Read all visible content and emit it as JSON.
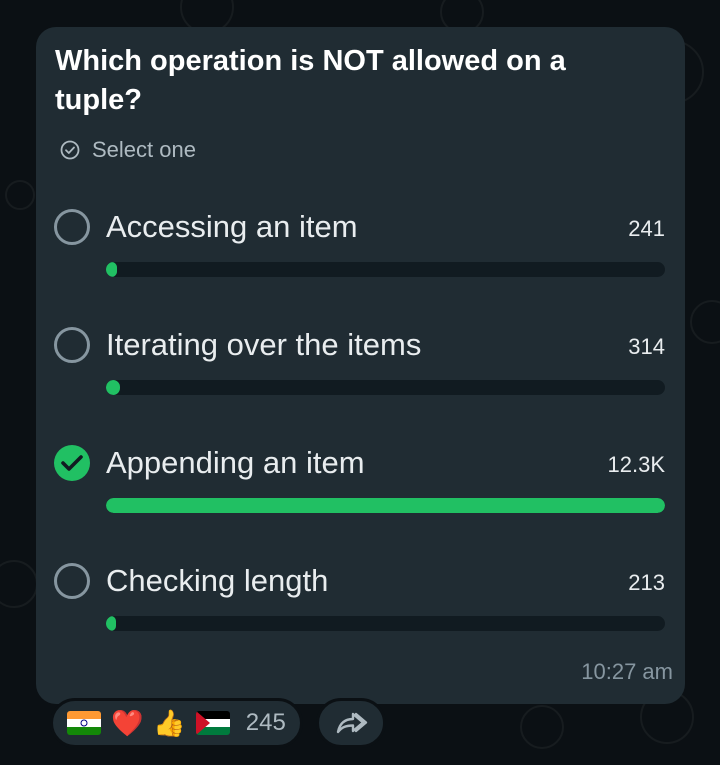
{
  "poll": {
    "question": "Which operation is NOT allowed on a tuple?",
    "instruction": "Select one",
    "options": [
      {
        "label": "Accessing an item",
        "count": "241",
        "fraction": 0.019,
        "selected": false
      },
      {
        "label": "Iterating over the items",
        "count": "314",
        "fraction": 0.025,
        "selected": false
      },
      {
        "label": "Appending an item",
        "count": "12.3K",
        "fraction": 1.0,
        "selected": true
      },
      {
        "label": "Checking length",
        "count": "213",
        "fraction": 0.017,
        "selected": false
      }
    ],
    "timestamp": "10:27 am"
  },
  "reactions": {
    "emojis": [
      "india-flag",
      "red-heart",
      "thumbs-up",
      "palestine-flag"
    ],
    "heart": "❤️",
    "thumbs": "👍",
    "count": "245"
  },
  "colors": {
    "accent": "#21c063",
    "bubble": "#202c33",
    "background": "#0b1014"
  },
  "icons": {
    "instruction_icon": "check-circle-icon",
    "share": "forward-arrow-icon"
  }
}
